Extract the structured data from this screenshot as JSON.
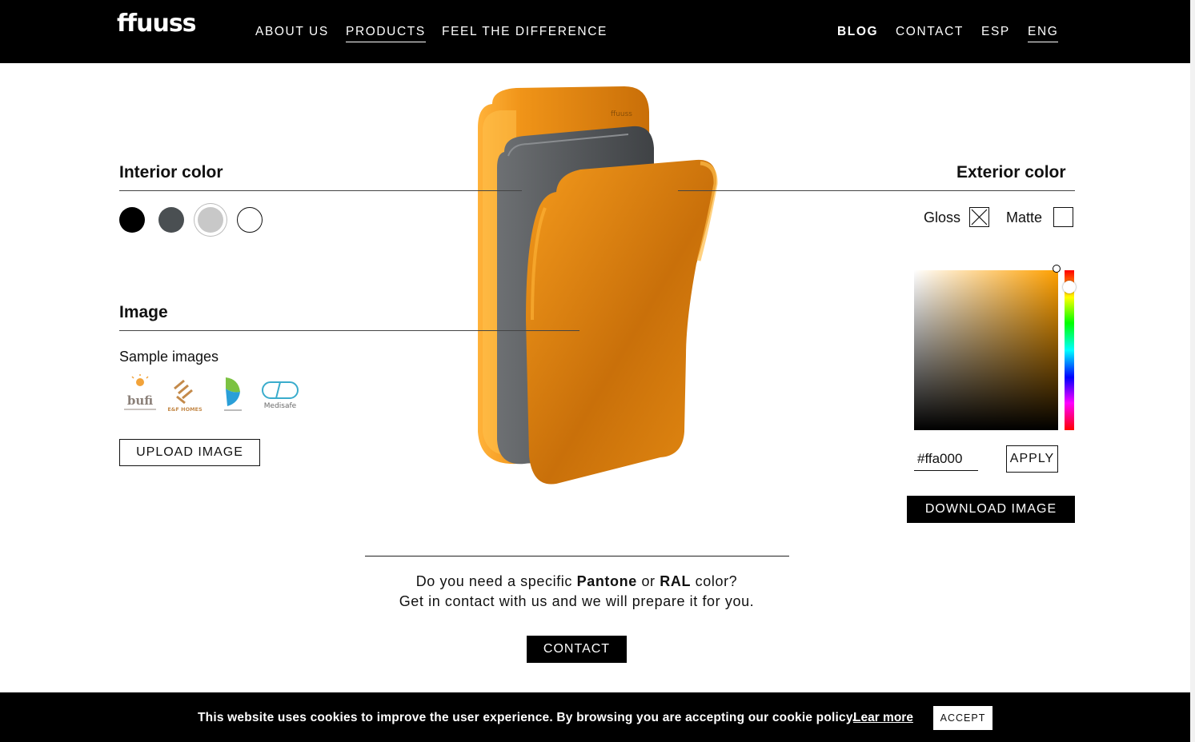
{
  "header": {
    "logo": "ffuuss",
    "nav_left": [
      "ABOUT US",
      "PRODUCTS",
      "FEEL THE DIFFERENCE"
    ],
    "nav_right": [
      "BLOG",
      "CONTACT",
      "ESP",
      "ENG"
    ],
    "active_item": "PRODUCTS"
  },
  "interior": {
    "title": "Interior color",
    "swatches": [
      "#000000",
      "#4a4f52",
      "#c8c8c8",
      "#ffffff"
    ],
    "selected_swatch": "#c8c8c8"
  },
  "image": {
    "title": "Image",
    "sample_label": "Sample images",
    "samples": [
      "bufi",
      "E&F HOMES",
      "leaf-logo",
      "Medisafe"
    ],
    "upload_button": "UPLOAD IMAGE"
  },
  "exterior": {
    "title": "Exterior color",
    "finish_options": [
      "Gloss",
      "Matte"
    ],
    "gloss_checked": true,
    "matte_checked": false,
    "hex_value": "#ffa000",
    "apply_button": "APPLY",
    "download_button": "DOWNLOAD IMAGE"
  },
  "product": {
    "accent_color": "#ffa000",
    "interior_color": "#5f6366",
    "brand_mark": "ffuuss"
  },
  "contact_section": {
    "line1_pre": "Do you need a specific",
    "pantone": "Pantone",
    "or": "or",
    "ral": "RAL",
    "line1_post": "color?",
    "line2": "Get in contact with us and we will prepare it for you.",
    "button": "CONTACT"
  },
  "cookie_bar": {
    "text": "This website uses cookies to improve the user experience. By browsing you are accepting our cookie policy.",
    "link": "Lear more",
    "accept": "ACCEPT"
  }
}
